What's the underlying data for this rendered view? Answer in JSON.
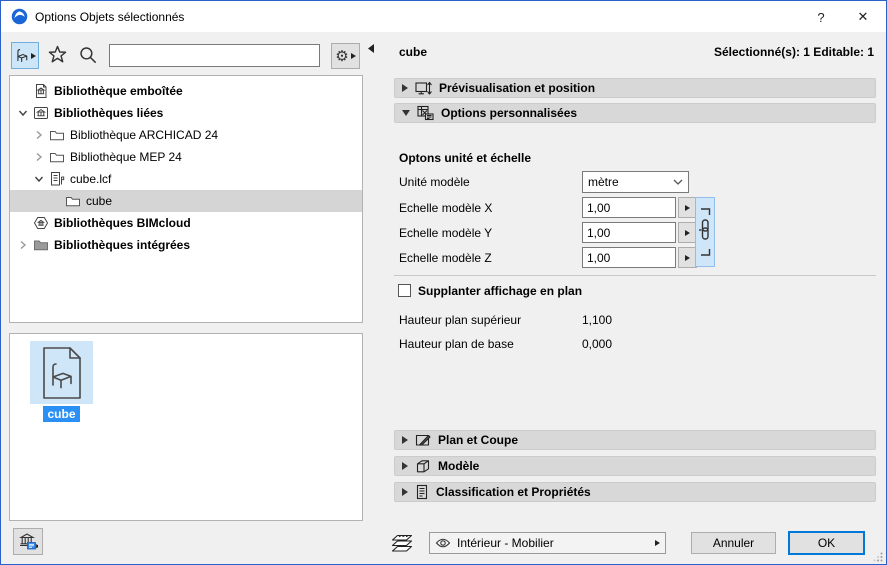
{
  "window": {
    "title": "Options Objets sélectionnés",
    "help_label": "?",
    "close_label": "✕"
  },
  "left": {
    "search": {
      "value": "",
      "placeholder": ""
    },
    "tree": [
      {
        "label": "Bibliothèque emboîtée",
        "icon": "doc-bank-icon",
        "chevron": "none",
        "bold": true
      },
      {
        "label": "Bibliothèques liées",
        "icon": "box-bank-icon",
        "chevron": "down",
        "bold": true
      },
      {
        "label": "Bibliothèque ARCHICAD 24",
        "icon": "folder-icon",
        "chevron": "right",
        "bold": false
      },
      {
        "label": "Bibliothèque MEP 24",
        "icon": "folder-icon",
        "chevron": "right",
        "bold": false
      },
      {
        "label": "cube.lcf",
        "icon": "doc-pin-icon",
        "chevron": "down",
        "bold": false
      },
      {
        "label": "cube",
        "icon": "folder-icon",
        "chevron": "none",
        "bold": false,
        "selected": true
      },
      {
        "label": "Bibliothèques BIMcloud",
        "icon": "hexagon-bank-icon",
        "chevron": "none",
        "bold": true
      },
      {
        "label": "Bibliothèques intégrées",
        "icon": "folder-dark-icon",
        "chevron": "right",
        "bold": true
      }
    ],
    "preview_item": {
      "label": "cube"
    }
  },
  "right": {
    "object_name": "cube",
    "selection_info": "Sélectionné(s): 1 Editable: 1",
    "sections": {
      "preview": "Prévisualisation et position",
      "custom": "Options personnalisées",
      "plan": "Plan et Coupe",
      "model": "Modèle",
      "classification": "Classification et Propriétés"
    },
    "custom_panel": {
      "group_title": "Optons unité et échelle",
      "unit_label": "Unité modèle",
      "unit_value": "mètre",
      "scale_x_label": "Echelle modèle X",
      "scale_x_value": "1,00",
      "scale_y_label": "Echelle modèle Y",
      "scale_y_value": "1,00",
      "scale_z_label": "Echelle modèle Z",
      "scale_z_value": "1,00",
      "override_label": "Supplanter affichage en plan",
      "top_height_label": "Hauteur plan supérieur",
      "top_height_value": "1,100",
      "base_height_label": "Hauteur plan de base",
      "base_height_value": "0,000"
    },
    "footer": {
      "layer_value": "Intérieur - Mobilier",
      "cancel_label": "Annuler",
      "ok_label": "OK"
    }
  },
  "colors": {
    "accent_blue": "#0078d7",
    "selection_blue": "#2a90f5",
    "tile_blue": "#cfe6f8",
    "window_border": "#2a60c8"
  }
}
